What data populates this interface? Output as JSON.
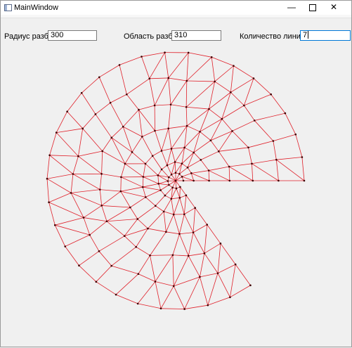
{
  "window": {
    "title": "MainWindow",
    "min_glyph": "—",
    "close_glyph": "✕"
  },
  "controls": {
    "radius": {
      "label": "Радиус разбиения",
      "value": "300"
    },
    "area": {
      "label": "Область разбиения",
      "value": "310"
    },
    "levels": {
      "label": "Количество линий уровня",
      "value": "7"
    }
  },
  "colors": {
    "mesh_edge": "#e0202a",
    "mesh_node": "#3a0000",
    "window_bg": "#f0f0f0"
  }
}
